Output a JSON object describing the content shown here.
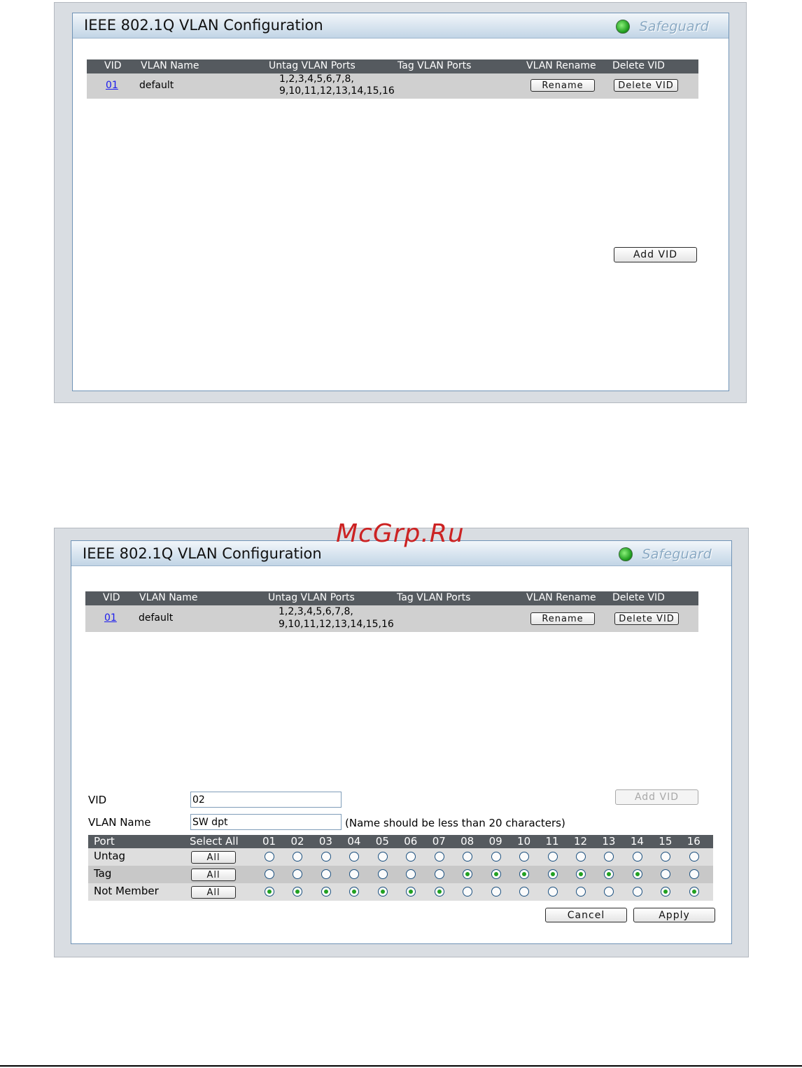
{
  "panel_title": "IEEE 802.1Q VLAN Configuration",
  "safeguard_label": "Safeguard",
  "table_headers": {
    "vid": "VID",
    "vlan_name": "VLAN Name",
    "untag_ports": "Untag VLAN Ports",
    "tag_ports": "Tag VLAN Ports",
    "vlan_rename": "VLAN Rename",
    "delete_vid": "Delete VID"
  },
  "vlan_rows": [
    {
      "vid": "01",
      "name": "default",
      "untag_line1": "1,2,3,4,5,6,7,8,",
      "untag_line2": "9,10,11,12,13,14,15,16",
      "tag_ports": "",
      "rename_label": "Rename",
      "delete_label": "Delete VID"
    }
  ],
  "add_vid_label": "Add VID",
  "form": {
    "vid_label": "VID",
    "vid_value": "02",
    "name_label": "VLAN Name",
    "name_value": "SW dpt",
    "name_hint": "(Name should be less than 20 characters)"
  },
  "port_grid": {
    "port_header": "Port",
    "select_all_header": "Select All",
    "ports": [
      "01",
      "02",
      "03",
      "04",
      "05",
      "06",
      "07",
      "08",
      "09",
      "10",
      "11",
      "12",
      "13",
      "14",
      "15",
      "16"
    ],
    "all_label": "All",
    "rows": [
      {
        "label": "Untag",
        "selected": [
          false,
          false,
          false,
          false,
          false,
          false,
          false,
          false,
          false,
          false,
          false,
          false,
          false,
          false,
          false,
          false
        ]
      },
      {
        "label": "Tag",
        "selected": [
          false,
          false,
          false,
          false,
          false,
          false,
          false,
          true,
          true,
          true,
          true,
          true,
          true,
          true,
          false,
          false
        ]
      },
      {
        "label": "Not Member",
        "selected": [
          true,
          true,
          true,
          true,
          true,
          true,
          true,
          false,
          false,
          false,
          false,
          false,
          false,
          false,
          true,
          true
        ]
      }
    ]
  },
  "cancel_label": "Cancel",
  "apply_label": "Apply",
  "watermark": "McGrp.Ru",
  "colors": {
    "table_header_bg": "#555a5f",
    "row_bg": "#d0d0d0",
    "panel_border": "#6f93b6",
    "radio_selected": "#21a121",
    "link": "#1a1aee"
  }
}
